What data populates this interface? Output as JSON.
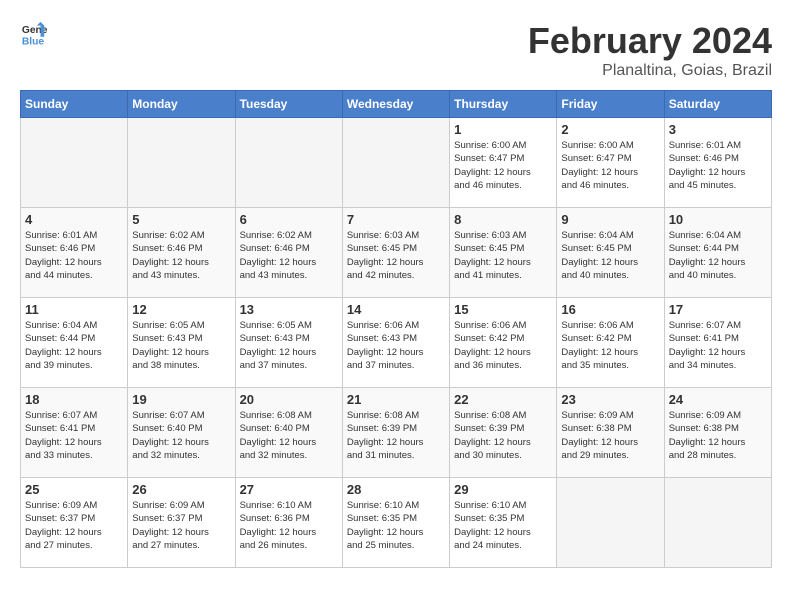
{
  "logo": {
    "line1": "General",
    "line2": "Blue"
  },
  "title": "February 2024",
  "subtitle": "Planaltina, Goias, Brazil",
  "weekdays": [
    "Sunday",
    "Monday",
    "Tuesday",
    "Wednesday",
    "Thursday",
    "Friday",
    "Saturday"
  ],
  "weeks": [
    [
      {
        "day": "",
        "info": ""
      },
      {
        "day": "",
        "info": ""
      },
      {
        "day": "",
        "info": ""
      },
      {
        "day": "",
        "info": ""
      },
      {
        "day": "1",
        "info": "Sunrise: 6:00 AM\nSunset: 6:47 PM\nDaylight: 12 hours\nand 46 minutes."
      },
      {
        "day": "2",
        "info": "Sunrise: 6:00 AM\nSunset: 6:47 PM\nDaylight: 12 hours\nand 46 minutes."
      },
      {
        "day": "3",
        "info": "Sunrise: 6:01 AM\nSunset: 6:46 PM\nDaylight: 12 hours\nand 45 minutes."
      }
    ],
    [
      {
        "day": "4",
        "info": "Sunrise: 6:01 AM\nSunset: 6:46 PM\nDaylight: 12 hours\nand 44 minutes."
      },
      {
        "day": "5",
        "info": "Sunrise: 6:02 AM\nSunset: 6:46 PM\nDaylight: 12 hours\nand 43 minutes."
      },
      {
        "day": "6",
        "info": "Sunrise: 6:02 AM\nSunset: 6:46 PM\nDaylight: 12 hours\nand 43 minutes."
      },
      {
        "day": "7",
        "info": "Sunrise: 6:03 AM\nSunset: 6:45 PM\nDaylight: 12 hours\nand 42 minutes."
      },
      {
        "day": "8",
        "info": "Sunrise: 6:03 AM\nSunset: 6:45 PM\nDaylight: 12 hours\nand 41 minutes."
      },
      {
        "day": "9",
        "info": "Sunrise: 6:04 AM\nSunset: 6:45 PM\nDaylight: 12 hours\nand 40 minutes."
      },
      {
        "day": "10",
        "info": "Sunrise: 6:04 AM\nSunset: 6:44 PM\nDaylight: 12 hours\nand 40 minutes."
      }
    ],
    [
      {
        "day": "11",
        "info": "Sunrise: 6:04 AM\nSunset: 6:44 PM\nDaylight: 12 hours\nand 39 minutes."
      },
      {
        "day": "12",
        "info": "Sunrise: 6:05 AM\nSunset: 6:43 PM\nDaylight: 12 hours\nand 38 minutes."
      },
      {
        "day": "13",
        "info": "Sunrise: 6:05 AM\nSunset: 6:43 PM\nDaylight: 12 hours\nand 37 minutes."
      },
      {
        "day": "14",
        "info": "Sunrise: 6:06 AM\nSunset: 6:43 PM\nDaylight: 12 hours\nand 37 minutes."
      },
      {
        "day": "15",
        "info": "Sunrise: 6:06 AM\nSunset: 6:42 PM\nDaylight: 12 hours\nand 36 minutes."
      },
      {
        "day": "16",
        "info": "Sunrise: 6:06 AM\nSunset: 6:42 PM\nDaylight: 12 hours\nand 35 minutes."
      },
      {
        "day": "17",
        "info": "Sunrise: 6:07 AM\nSunset: 6:41 PM\nDaylight: 12 hours\nand 34 minutes."
      }
    ],
    [
      {
        "day": "18",
        "info": "Sunrise: 6:07 AM\nSunset: 6:41 PM\nDaylight: 12 hours\nand 33 minutes."
      },
      {
        "day": "19",
        "info": "Sunrise: 6:07 AM\nSunset: 6:40 PM\nDaylight: 12 hours\nand 32 minutes."
      },
      {
        "day": "20",
        "info": "Sunrise: 6:08 AM\nSunset: 6:40 PM\nDaylight: 12 hours\nand 32 minutes."
      },
      {
        "day": "21",
        "info": "Sunrise: 6:08 AM\nSunset: 6:39 PM\nDaylight: 12 hours\nand 31 minutes."
      },
      {
        "day": "22",
        "info": "Sunrise: 6:08 AM\nSunset: 6:39 PM\nDaylight: 12 hours\nand 30 minutes."
      },
      {
        "day": "23",
        "info": "Sunrise: 6:09 AM\nSunset: 6:38 PM\nDaylight: 12 hours\nand 29 minutes."
      },
      {
        "day": "24",
        "info": "Sunrise: 6:09 AM\nSunset: 6:38 PM\nDaylight: 12 hours\nand 28 minutes."
      }
    ],
    [
      {
        "day": "25",
        "info": "Sunrise: 6:09 AM\nSunset: 6:37 PM\nDaylight: 12 hours\nand 27 minutes."
      },
      {
        "day": "26",
        "info": "Sunrise: 6:09 AM\nSunset: 6:37 PM\nDaylight: 12 hours\nand 27 minutes."
      },
      {
        "day": "27",
        "info": "Sunrise: 6:10 AM\nSunset: 6:36 PM\nDaylight: 12 hours\nand 26 minutes."
      },
      {
        "day": "28",
        "info": "Sunrise: 6:10 AM\nSunset: 6:35 PM\nDaylight: 12 hours\nand 25 minutes."
      },
      {
        "day": "29",
        "info": "Sunrise: 6:10 AM\nSunset: 6:35 PM\nDaylight: 12 hours\nand 24 minutes."
      },
      {
        "day": "",
        "info": ""
      },
      {
        "day": "",
        "info": ""
      }
    ]
  ]
}
